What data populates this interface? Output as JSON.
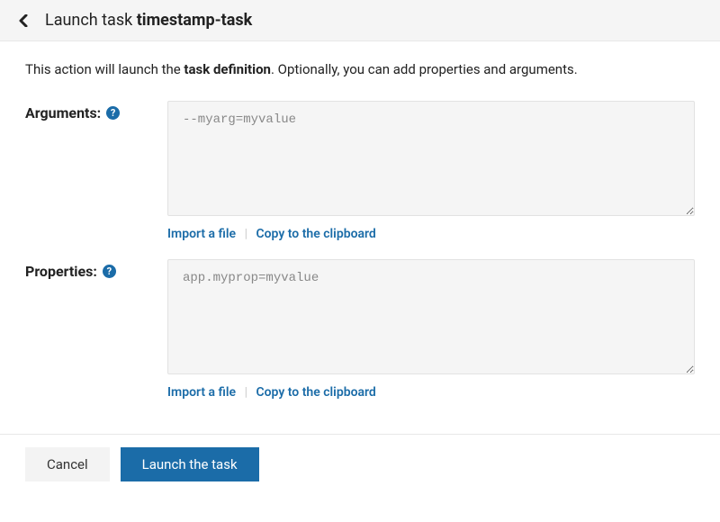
{
  "header": {
    "title_prefix": "Launch task ",
    "task_name": "timestamp-task"
  },
  "intro": {
    "part1": "This action will launch the ",
    "bold": "task definition",
    "part2": ". Optionally, you can add properties and arguments."
  },
  "arguments": {
    "label": "Arguments:",
    "placeholder": "--myarg=myvalue",
    "value": "",
    "import_label": "Import a file",
    "copy_label": "Copy to the clipboard"
  },
  "properties": {
    "label": "Properties:",
    "placeholder": "app.myprop=myvalue",
    "value": "",
    "import_label": "Import a file",
    "copy_label": "Copy to the clipboard"
  },
  "footer": {
    "cancel_label": "Cancel",
    "launch_label": "Launch the task"
  },
  "help_icon_glyph": "?"
}
